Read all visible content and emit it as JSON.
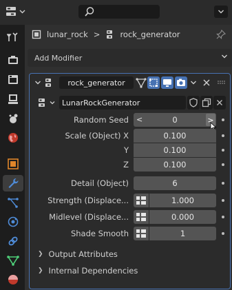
{
  "breadcrumb": {
    "object": "lunar_rock",
    "separator": ">",
    "modifier": "rock_generator"
  },
  "add_modifier": {
    "label": "Add Modifier"
  },
  "modifier": {
    "name": "rock_generator",
    "node_group": "LunarRockGenerator",
    "parameters": [
      {
        "label": "Random Seed",
        "value": "0",
        "type": "int-arrows"
      },
      {
        "label": "Scale (Object) X",
        "value": "0.100",
        "type": "vector"
      },
      {
        "label": "Y",
        "value": "0.100",
        "type": "vector"
      },
      {
        "label": "Z",
        "value": "0.100",
        "type": "vector"
      },
      {
        "label": "Detail (Object)",
        "value": "6",
        "type": "int"
      },
      {
        "label": "Strength (Displace...",
        "value": "1.000",
        "type": "field-input"
      },
      {
        "label": "Midlevel (Displace...",
        "value": "0.000",
        "type": "field-input"
      },
      {
        "label": "Shade Smooth",
        "value": "1",
        "type": "field-input"
      }
    ],
    "subpanels": [
      {
        "label": "Output Attributes"
      },
      {
        "label": "Internal Dependencies"
      }
    ]
  },
  "icons": {
    "tabs": [
      "tool-icon",
      "render-icon",
      "output-icon",
      "view-layer-icon",
      "scene-icon",
      "world-icon",
      "object-icon",
      "modifier-wrench-icon",
      "particles-icon",
      "physics-icon",
      "constraints-icon",
      "object-data-icon",
      "material-icon"
    ]
  },
  "colors": {
    "accent": "#4772b3",
    "panel_bg": "#2b2b2b",
    "field_bg": "#545454",
    "window_bg": "#303030"
  }
}
